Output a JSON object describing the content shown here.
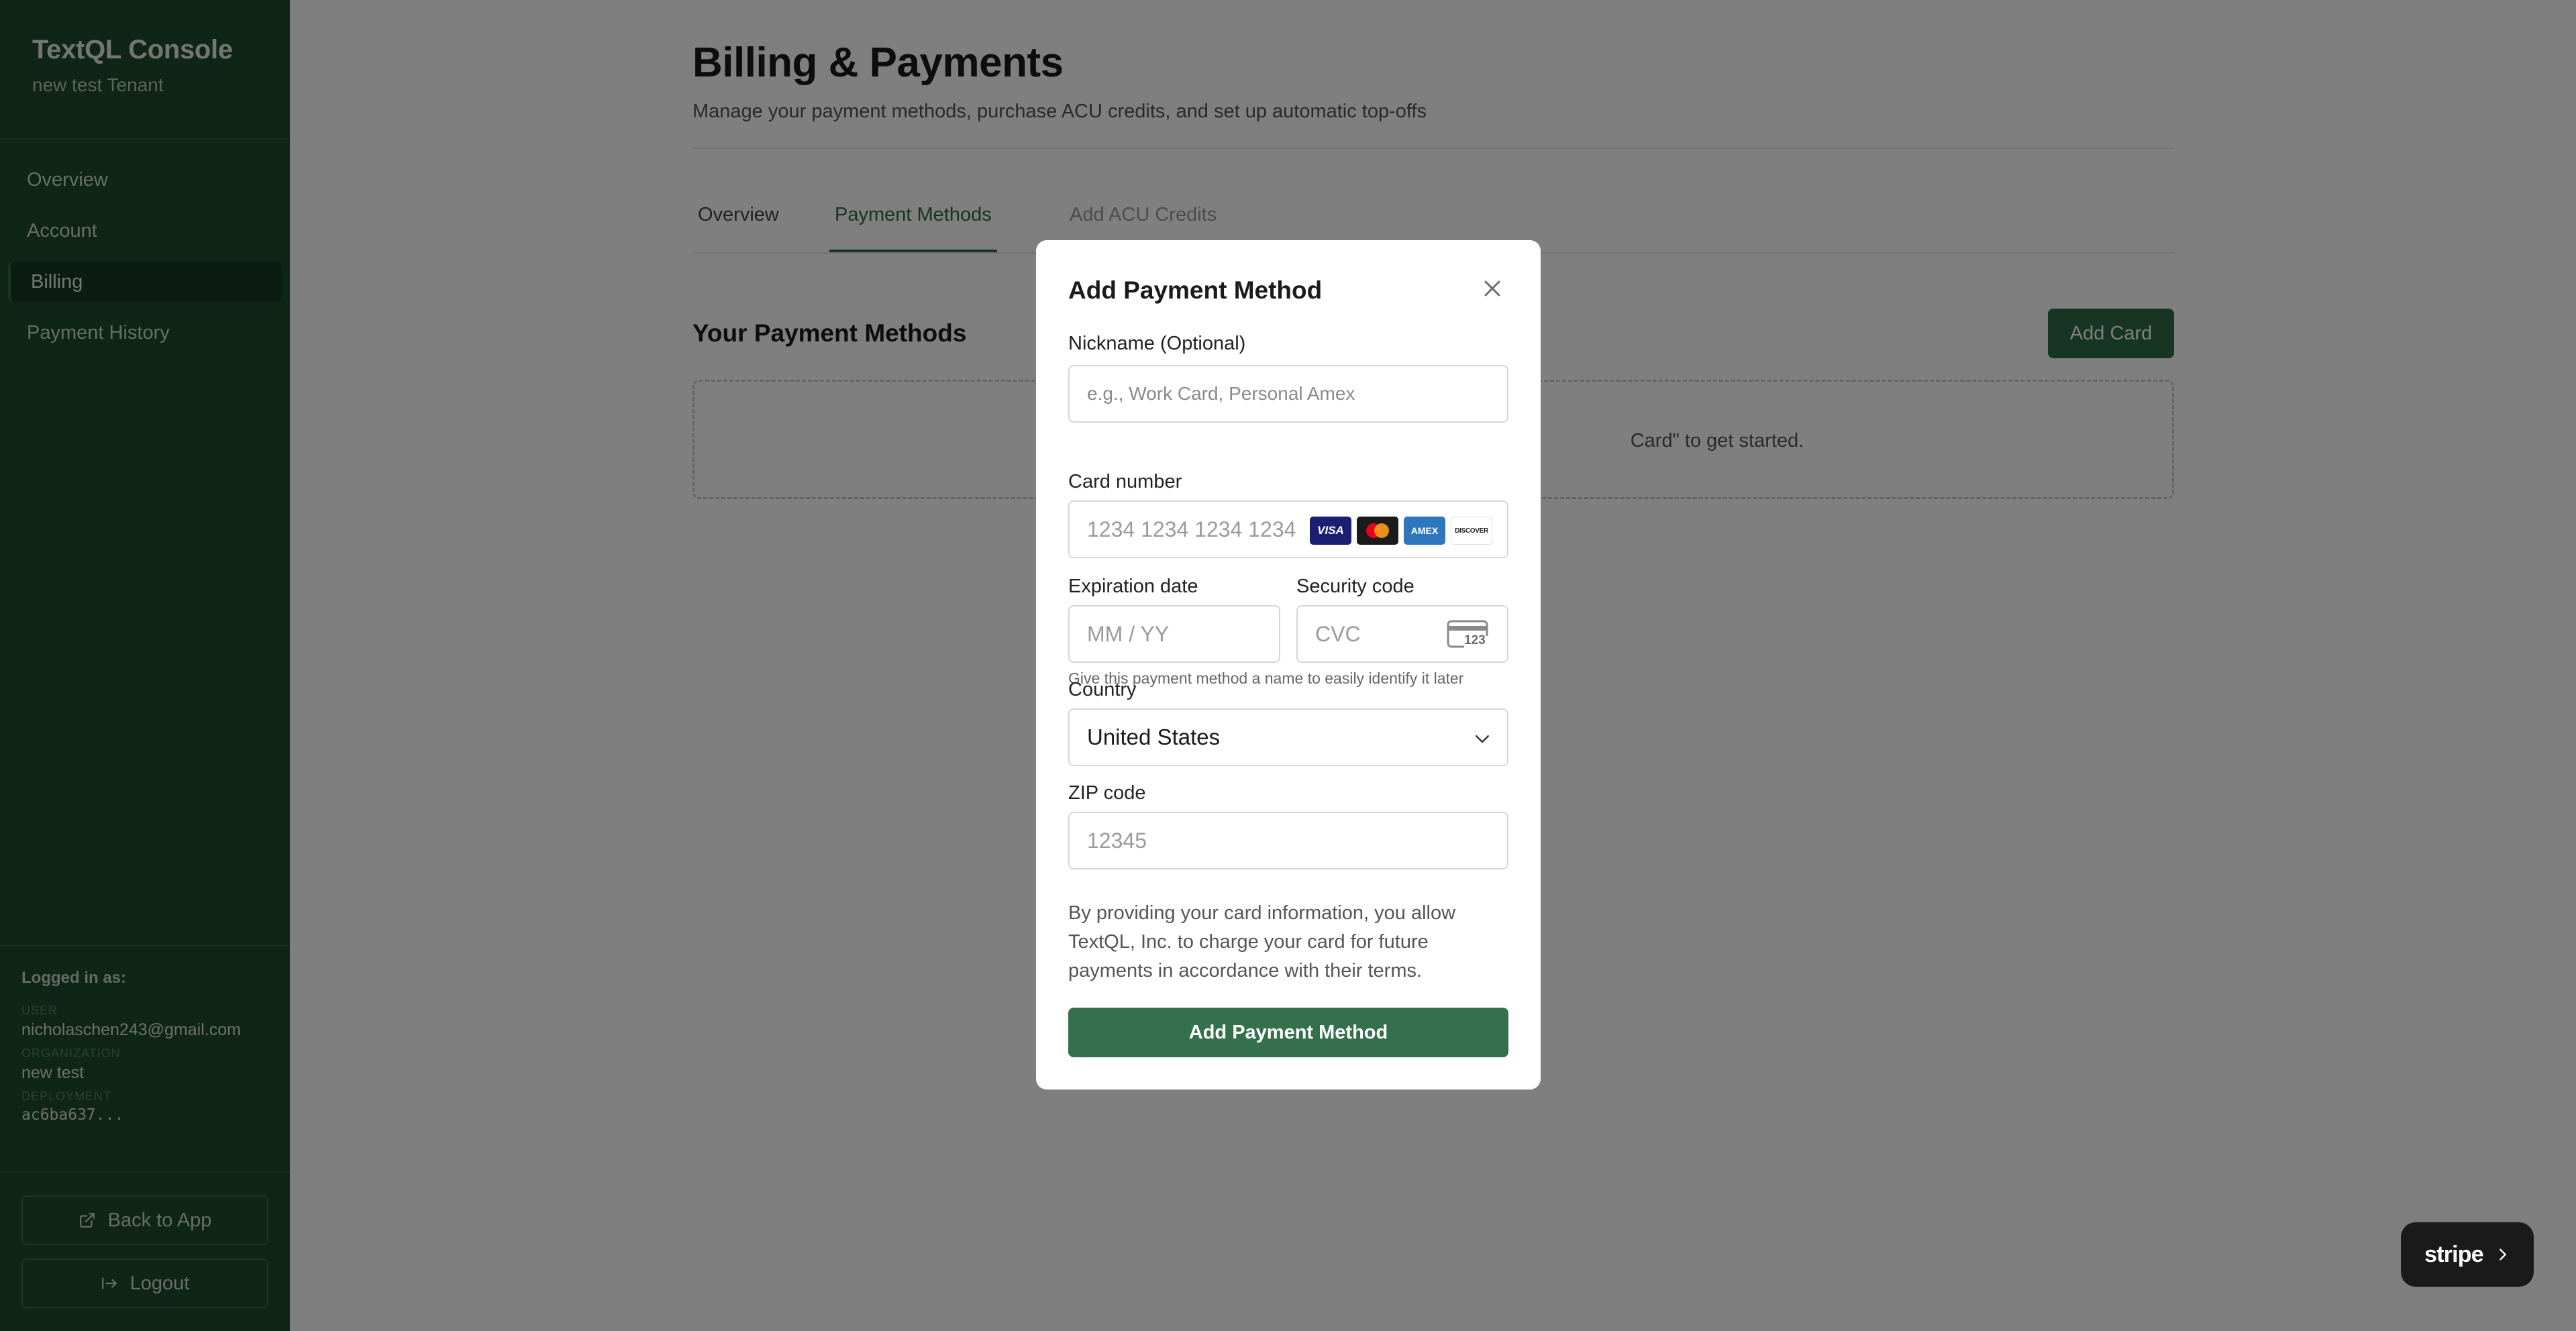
{
  "sidebar": {
    "brand_title": "TextQL Console",
    "brand_subtitle": "new test Tenant",
    "nav": [
      {
        "label": "Overview",
        "active": false
      },
      {
        "label": "Account",
        "active": false
      },
      {
        "label": "Billing",
        "active": true
      },
      {
        "label": "Payment History",
        "active": false
      }
    ],
    "logged_in_title": "Logged in as:",
    "user_label": "USER",
    "user_value": "nicholaschen243@gmail.com",
    "org_label": "ORGANIZATION",
    "org_value": "new test",
    "deployment_label": "DEPLOYMENT",
    "deployment_value": "ac6ba637...",
    "back_button": "Back to App",
    "logout_button": "Logout"
  },
  "main": {
    "title": "Billing & Payments",
    "subtitle": "Manage your payment methods, purchase ACU credits, and set up automatic top-offs",
    "tabs": [
      {
        "label": "Overview",
        "state": "default"
      },
      {
        "label": "Payment Methods",
        "state": "active"
      },
      {
        "label": "Add ACU Credits",
        "state": "muted"
      }
    ],
    "section_title": "Your Payment Methods",
    "add_card_button": "Add Card",
    "empty_text": "Card\" to get started."
  },
  "modal": {
    "title": "Add Payment Method",
    "nickname_label": "Nickname (Optional)",
    "nickname_placeholder": "e.g., Work Card, Personal Amex",
    "nickname_help": "Give this payment method a name to easily identify it later",
    "card_number_label": "Card number",
    "card_number_placeholder": "1234 1234 1234 1234",
    "card_brands": [
      "VISA",
      "mastercard",
      "AMEX",
      "DISCOVER"
    ],
    "expiration_label": "Expiration date",
    "expiration_placeholder": "MM / YY",
    "security_label": "Security code",
    "security_placeholder": "CVC",
    "cvc_icon_text": "123",
    "country_label": "Country",
    "country_value": "United States",
    "zip_label": "ZIP code",
    "zip_placeholder": "12345",
    "consent_text": "By providing your card information, you allow TextQL, Inc. to charge your card for future payments in accordance with their terms.",
    "submit_button": "Add Payment Method"
  },
  "stripe_badge": {
    "label": "stripe"
  },
  "colors": {
    "sidebar_bg": "#1f4a30",
    "accent_green": "#2f6b47",
    "overlay": "rgba(0,0,0,0.5)",
    "visa_blue": "#1a1f71",
    "amex_blue": "#2e77bc"
  }
}
